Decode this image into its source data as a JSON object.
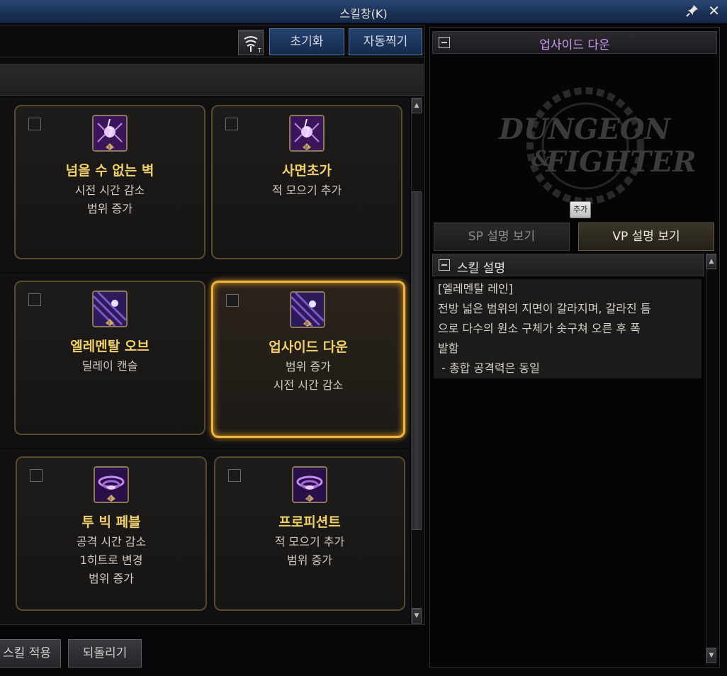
{
  "window": {
    "title": "스킬창(K)",
    "pin_icon": "pin-icon",
    "close_icon": "close-icon"
  },
  "toolbar": {
    "tool_icon": "wind-swirl-icon",
    "reset_label": "초기화",
    "auto_label": "자동찍기"
  },
  "cards": [
    {
      "name": "넘을 수 없는 벽",
      "desc1": "시전 시간 감소",
      "desc2": "범위 증가",
      "desc3": "",
      "tier": "I"
    },
    {
      "name": "사면초가",
      "desc1": "적 모으기 추가",
      "desc2": "",
      "desc3": "",
      "tier": "II"
    },
    {
      "name": "엘레멘탈 오브",
      "desc1": "딜레이 캔슬",
      "desc2": "",
      "desc3": "",
      "tier": "I"
    },
    {
      "name": "업사이드 다운",
      "desc1": "범위 증가",
      "desc2": "시전 시간 감소",
      "desc3": "",
      "tier": "II"
    },
    {
      "name": "투 빅 페블",
      "desc1": "공격 시간 감소",
      "desc2": "1히트로 변경",
      "desc3": "범위 증가",
      "tier": "I"
    },
    {
      "name": "프로피션트",
      "desc1": "적 모으기 추가",
      "desc2": "범위 증가",
      "desc3": "",
      "tier": "II"
    }
  ],
  "bottom": {
    "apply_label": "스킬 적용",
    "revert_label": "되돌리기"
  },
  "detail": {
    "title": "업사이드 다운",
    "logo_line1": "DUNGEON",
    "logo_amp": "&",
    "logo_line2": "FIGHTER",
    "add_label": "추가",
    "sp_tab": "SP 설명 보기",
    "vp_tab": "VP 설명 보기",
    "desc_header": "스킬 설명",
    "desc_lines": [
      "[엘레멘탈 레인]",
      "전방 넓은 범위의 지면이 갈라지며, 갈라진 틈",
      "으로 다수의 원소 구체가 솟구쳐 오른 후 폭",
      "발함",
      " - 총합 공격력은 동일"
    ]
  },
  "colors": {
    "accent_gold": "#f0b53a",
    "name_gold": "#f0d06a",
    "title_purple": "#c89bf0",
    "titlebar_blue": "#1b3256"
  }
}
